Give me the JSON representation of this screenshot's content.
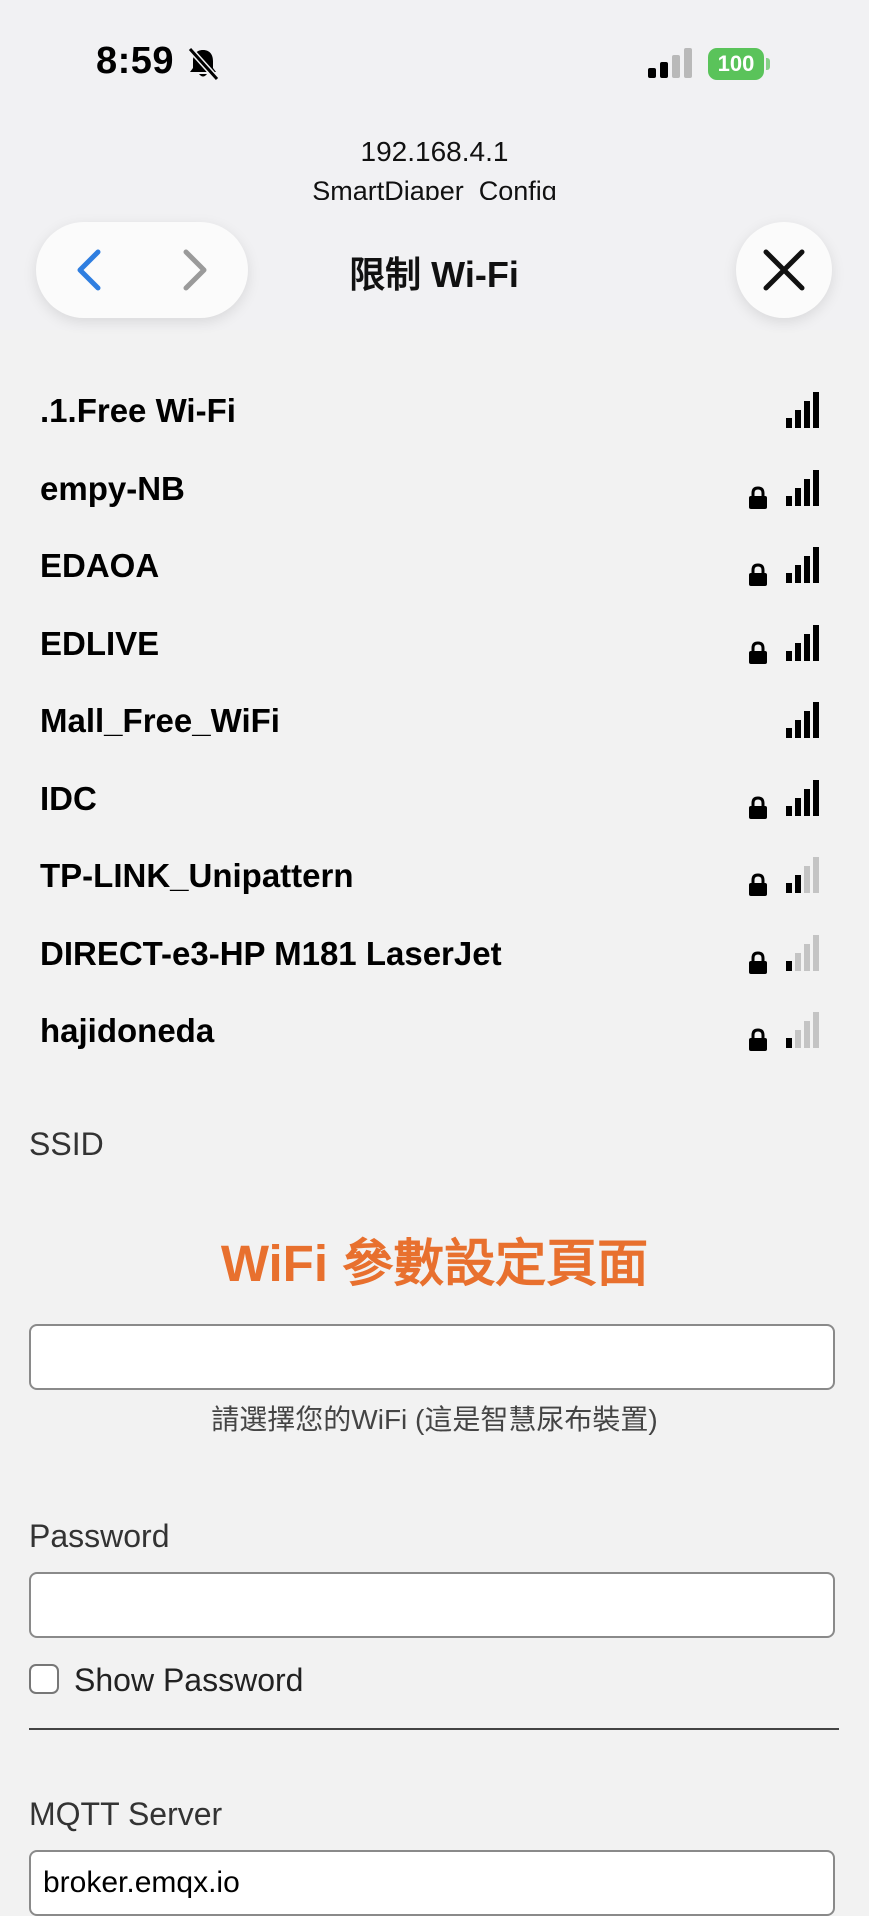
{
  "status_bar": {
    "time": "8:59",
    "battery": "100",
    "icons": [
      "bell-slash-icon",
      "cellular-signal-icon",
      "battery-icon"
    ]
  },
  "header": {
    "url": "192.168.4.1",
    "subtitle": "SmartDiaper_Config",
    "title": "限制 Wi-Fi",
    "back_icon": "chevron-left-icon",
    "forward_icon": "chevron-right-icon",
    "close_icon": "close-icon"
  },
  "wifi_networks": [
    {
      "name": ".1.Free Wi-Fi",
      "locked": false,
      "signal_level": 4
    },
    {
      "name": "empy-NB",
      "locked": true,
      "signal_level": 4
    },
    {
      "name": "EDAOA",
      "locked": true,
      "signal_level": 4
    },
    {
      "name": "EDLIVE",
      "locked": true,
      "signal_level": 4
    },
    {
      "name": "Mall_Free_WiFi",
      "locked": false,
      "signal_level": 4
    },
    {
      "name": "IDC",
      "locked": true,
      "signal_level": 4
    },
    {
      "name": "TP-LINK_Unipattern",
      "locked": true,
      "signal_level": 2
    },
    {
      "name": "DIRECT-e3-HP M181 LaserJet",
      "locked": true,
      "signal_level": 1
    },
    {
      "name": "hajidoneda",
      "locked": true,
      "signal_level": 1
    }
  ],
  "form": {
    "ssid_label": "SSID",
    "heading": "WiFi 參數設定頁面",
    "ssid_value": "",
    "ssid_hint": "請選擇您的WiFi (這是智慧尿布裝置)",
    "password_label": "Password",
    "password_value": "",
    "show_password_label": "Show Password",
    "show_password_checked": false,
    "mqtt_label": "MQTT Server",
    "mqtt_value": "broker.emqx.io"
  },
  "colors": {
    "heading": "#e8702e",
    "link_blue": "#2f7ee0",
    "battery_green": "#5ac35a"
  }
}
